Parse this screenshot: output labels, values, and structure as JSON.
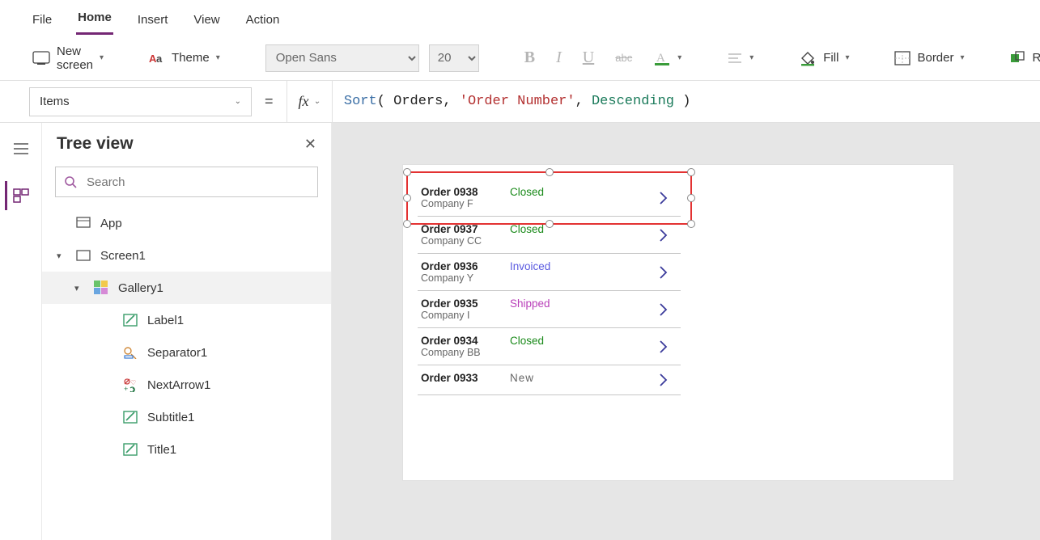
{
  "menu": {
    "items": [
      "File",
      "Home",
      "Insert",
      "View",
      "Action"
    ],
    "active": 1
  },
  "ribbon": {
    "new_screen": "New screen",
    "theme": "Theme",
    "font_name": "Open Sans",
    "font_size": "20",
    "fill": "Fill",
    "border": "Border",
    "reorder": "Re"
  },
  "formula": {
    "property": "Items",
    "fx_label": "fx",
    "tokens": [
      {
        "t": "fn",
        "v": "Sort"
      },
      {
        "t": "plain",
        "v": "( Orders, "
      },
      {
        "t": "str",
        "v": "'Order Number'"
      },
      {
        "t": "plain",
        "v": ", "
      },
      {
        "t": "enum",
        "v": "Descending"
      },
      {
        "t": "plain",
        "v": " )"
      }
    ]
  },
  "tree": {
    "title": "Tree view",
    "search_placeholder": "Search",
    "nodes": [
      {
        "label": "App",
        "icon": "app",
        "level": 1,
        "expandable": false
      },
      {
        "label": "Screen1",
        "icon": "screen",
        "level": 2,
        "expandable": true,
        "expanded": true
      },
      {
        "label": "Gallery1",
        "icon": "gallery",
        "level": 3,
        "expandable": true,
        "expanded": true,
        "selected": true
      },
      {
        "label": "Label1",
        "icon": "label",
        "level": 4
      },
      {
        "label": "Separator1",
        "icon": "separator",
        "level": 4
      },
      {
        "label": "NextArrow1",
        "icon": "nextarrow",
        "level": 4
      },
      {
        "label": "Subtitle1",
        "icon": "label",
        "level": 4
      },
      {
        "label": "Title1",
        "icon": "label",
        "level": 4
      }
    ]
  },
  "gallery_data": {
    "status_colors": {
      "Closed": "st-closed",
      "Invoiced": "st-invoiced",
      "Shipped": "st-shipped",
      "New": "st-new"
    },
    "items": [
      {
        "order": "Order 0938",
        "company": "Company F",
        "status": "Closed"
      },
      {
        "order": "Order 0937",
        "company": "Company CC",
        "status": "Closed"
      },
      {
        "order": "Order 0936",
        "company": "Company Y",
        "status": "Invoiced"
      },
      {
        "order": "Order 0935",
        "company": "Company I",
        "status": "Shipped"
      },
      {
        "order": "Order 0934",
        "company": "Company BB",
        "status": "Closed"
      },
      {
        "order": "Order 0933",
        "company": "",
        "status": "New"
      }
    ],
    "selected_index": 0
  }
}
